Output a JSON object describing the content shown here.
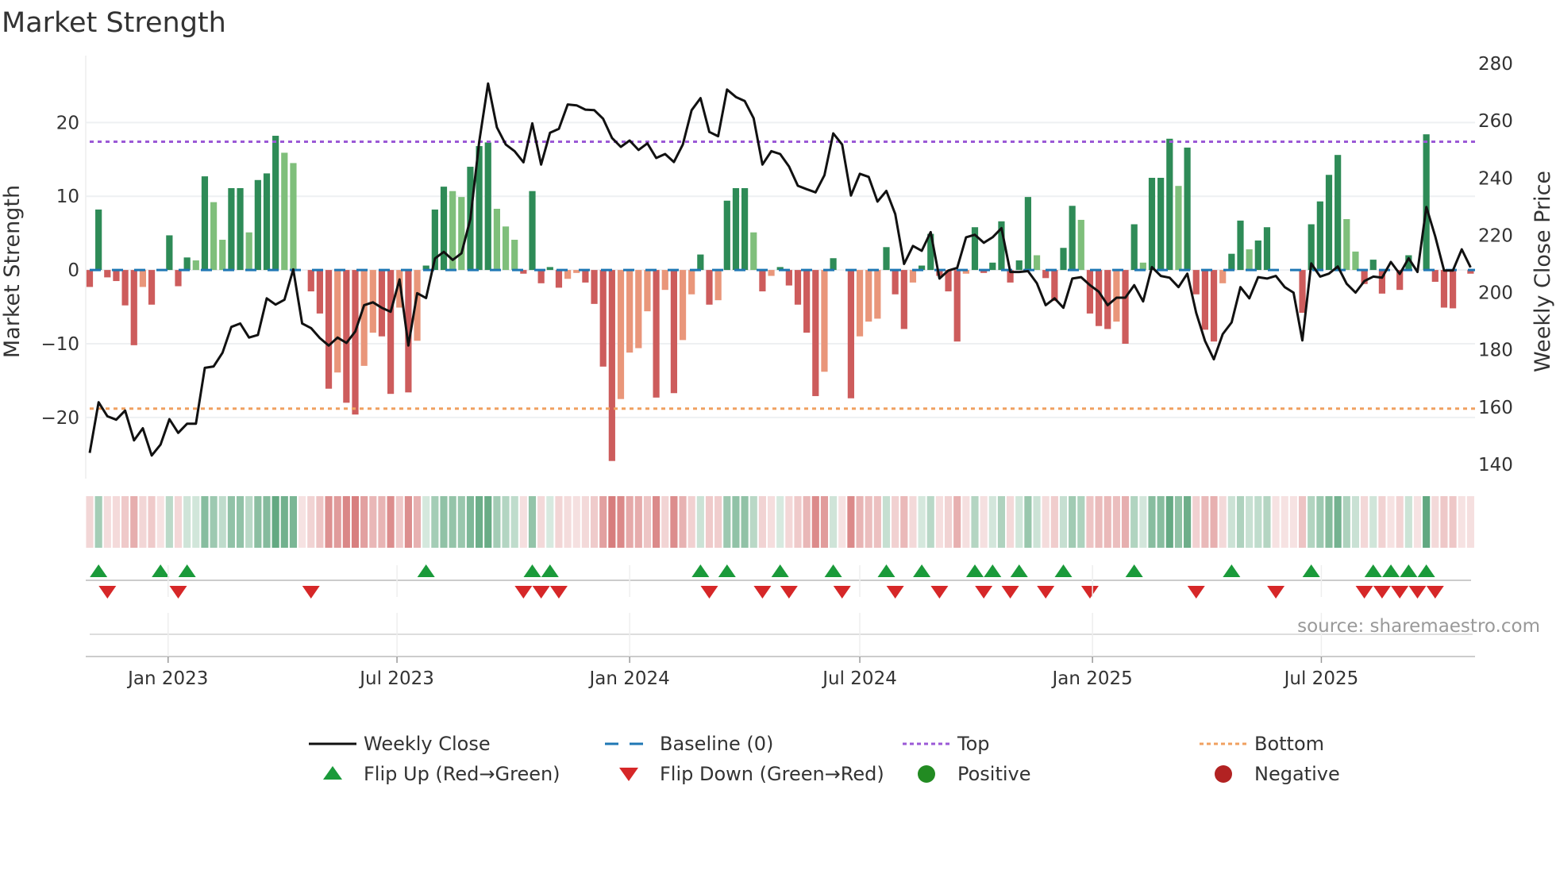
{
  "chart_data": {
    "type": "bar+line",
    "title": "Market Strength",
    "ylabel": "Market Strength",
    "y2label": "Weekly Close Price",
    "ylim": [
      -28.3,
      28
    ],
    "y2lim": [
      135,
      280
    ],
    "yticks": [
      -20,
      -10,
      0,
      10,
      20
    ],
    "yticks_labels": [
      "−20",
      "−10",
      "0",
      "10",
      "20"
    ],
    "y2ticks": [
      140,
      160,
      180,
      200,
      220,
      240,
      260,
      280
    ],
    "y2ticks_labels": [
      "140",
      "160",
      "180",
      "200",
      "220",
      "240",
      "260",
      "280"
    ],
    "week_start": "2022-10-31",
    "xticks": [
      {
        "date": "2023-01-01",
        "label": "Jan 2023"
      },
      {
        "date": "2023-07-01",
        "label": "Jul 2023"
      },
      {
        "date": "2024-01-01",
        "label": "Jan 2024"
      },
      {
        "date": "2024-07-01",
        "label": "Jul 2024"
      },
      {
        "date": "2025-01-01",
        "label": "Jan 2025"
      },
      {
        "date": "2025-07-01",
        "label": "Jul 2025"
      }
    ],
    "top_level": 17.4,
    "bottom_level": -18.8,
    "baseline": 0,
    "strength": [
      -2.3,
      8.2,
      -1.0,
      -1.5,
      -4.8,
      -10.2,
      -2.3,
      -4.7,
      0,
      4.7,
      -2.2,
      1.7,
      1.3,
      12.7,
      9.2,
      4.1,
      11.1,
      11.1,
      5.1,
      12.2,
      13.1,
      18.2,
      15.9,
      14.5,
      0,
      -2.9,
      -5.9,
      -16.1,
      -13.9,
      -18.0,
      -19.6,
      -13.0,
      -8.5,
      -9.0,
      -16.8,
      -5.1,
      -16.6,
      -9.6,
      0.6,
      8.2,
      11.3,
      10.7,
      9.9,
      14.0,
      16.8,
      17.3,
      8.3,
      5.9,
      4.1,
      -0.5,
      10.7,
      -1.8,
      0.4,
      -2.4,
      -1.2,
      -0.4,
      -1.7,
      -4.6,
      -13.1,
      -25.9,
      -17.5,
      -11.2,
      -10.6,
      -5.6,
      -17.3,
      -2.7,
      -16.7,
      -9.5,
      -3.3,
      2.1,
      -4.7,
      -4.1,
      9.4,
      11.1,
      11.1,
      5.1,
      -2.9,
      -0.8,
      0.4,
      -2.1,
      -4.7,
      -8.5,
      -17.1,
      -13.8,
      1.6,
      0,
      -17.4,
      -9.0,
      -7.0,
      -6.6,
      3.1,
      -3.3,
      -8.0,
      -1.7,
      0.6,
      4.9,
      -0.8,
      -2.9,
      -9.7,
      -0.5,
      5.8,
      -0.4,
      1.0,
      6.6,
      -1.7,
      1.3,
      9.9,
      2.0,
      -1.1,
      -4.2,
      3.0,
      8.7,
      6.8,
      -5.9,
      -7.6,
      -8.0,
      -7.0,
      -10.0,
      6.2,
      1.0,
      12.5,
      12.5,
      17.8,
      11.4,
      16.6,
      -3.3,
      -8.1,
      -9.7,
      -1.8,
      2.2,
      6.7,
      2.8,
      4.0,
      5.8,
      0,
      0,
      0,
      -5.8,
      6.2,
      9.3,
      12.9,
      15.6,
      6.9,
      2.5,
      -1.9,
      1.4,
      -3.2,
      0,
      -2.7,
      2.0,
      0,
      18.4,
      -1.6,
      -5.1,
      -5.2,
      0,
      -0.5
    ],
    "light_shade_weeks": [
      6,
      12,
      14,
      15,
      18,
      22,
      23,
      28,
      31,
      32,
      35,
      37,
      41,
      42,
      46,
      47,
      48,
      54,
      55,
      60,
      61,
      62,
      63,
      65,
      67,
      68,
      71,
      75,
      77,
      83,
      87,
      88,
      89,
      93,
      99,
      107,
      112,
      116,
      119,
      123,
      128,
      131,
      142,
      143
    ],
    "weekly_close": [
      144.0,
      161.7,
      156.8,
      155.6,
      158.8,
      148.4,
      152.6,
      143.1,
      146.9,
      155.8,
      151.0,
      154.2,
      154.2,
      173.7,
      174.2,
      179.0,
      188.0,
      189.2,
      184.3,
      185.2,
      198.0,
      195.8,
      197.5,
      208.1,
      189.2,
      187.6,
      184.1,
      181.5,
      184.3,
      182.4,
      186.4,
      195.6,
      196.6,
      194.7,
      193.3,
      204.6,
      181.5,
      199.8,
      198.1,
      211.9,
      214.2,
      211.4,
      213.7,
      225.7,
      252.6,
      273.0,
      257.7,
      251.7,
      249.4,
      245.5,
      259.1,
      244.7,
      255.8,
      257.2,
      265.7,
      265.4,
      263.9,
      263.7,
      260.7,
      254.0,
      250.9,
      253.1,
      249.8,
      252.1,
      247.0,
      248.4,
      245.6,
      251.7,
      263.7,
      267.9,
      256.1,
      254.6,
      270.9,
      268.3,
      266.9,
      260.9,
      244.7,
      249.4,
      248.4,
      244.0,
      237.3,
      236.1,
      235.0,
      241.0,
      255.6,
      251.7,
      233.9,
      241.5,
      240.4,
      231.8,
      235.5,
      227.4,
      210.0,
      216.3,
      214.6,
      221.1,
      204.9,
      207.7,
      208.6,
      219.3,
      220.2,
      217.4,
      219.3,
      222.5,
      207.2,
      207.2,
      207.5,
      203.3,
      195.6,
      198.0,
      194.7,
      204.9,
      205.4,
      202.6,
      200.3,
      195.6,
      198.2,
      198.2,
      202.6,
      196.9,
      208.9,
      205.8,
      205.2,
      201.9,
      206.6,
      192.9,
      183.1,
      176.7,
      185.5,
      189.6,
      201.9,
      198.0,
      205.4,
      204.9,
      205.8,
      201.9,
      200.0,
      183.3,
      210.2,
      205.6,
      206.6,
      209.1,
      203.1,
      200.0,
      204.0,
      205.6,
      205.2,
      210.7,
      206.5,
      212.0,
      207.2,
      229.9,
      219.7,
      207.7,
      207.7,
      215.1,
      208.8
    ],
    "flip_up_weeks": [
      1,
      8,
      11,
      38,
      50,
      52,
      69,
      72,
      78,
      84,
      90,
      94,
      100,
      102,
      105,
      110,
      118,
      129,
      138,
      145,
      147,
      149,
      151
    ],
    "flip_down_weeks": [
      2,
      10,
      25,
      49,
      51,
      53,
      70,
      76,
      79,
      85,
      91,
      96,
      101,
      104,
      108,
      113,
      125,
      134,
      144,
      146,
      148,
      150,
      152
    ],
    "legend": [
      {
        "key": "close",
        "label": "Weekly Close"
      },
      {
        "key": "baseline",
        "label": "Baseline (0)"
      },
      {
        "key": "top",
        "label": "Top"
      },
      {
        "key": "bottom",
        "label": "Bottom"
      },
      {
        "key": "flip_up",
        "label": "Flip Up (Red→Green)"
      },
      {
        "key": "flip_down",
        "label": "Flip Down (Green→Red)"
      },
      {
        "key": "positive",
        "label": "Positive"
      },
      {
        "key": "negative",
        "label": "Negative"
      }
    ],
    "legend_placement": "bottom",
    "source": "source: sharemaestro.com",
    "colors": {
      "pos_dark": "#2e8b57",
      "pos_light": "#7fbf7b",
      "neg_dark": "#cd5c5c",
      "neg_light": "#e9967a",
      "close": "#111111",
      "baseline": "#1f77b4",
      "top": "#9b59d6",
      "bottom": "#f0a060",
      "flip_up": "#1a9a3a",
      "flip_down": "#d62728",
      "positive": "#228b22",
      "negative": "#b22222"
    }
  }
}
